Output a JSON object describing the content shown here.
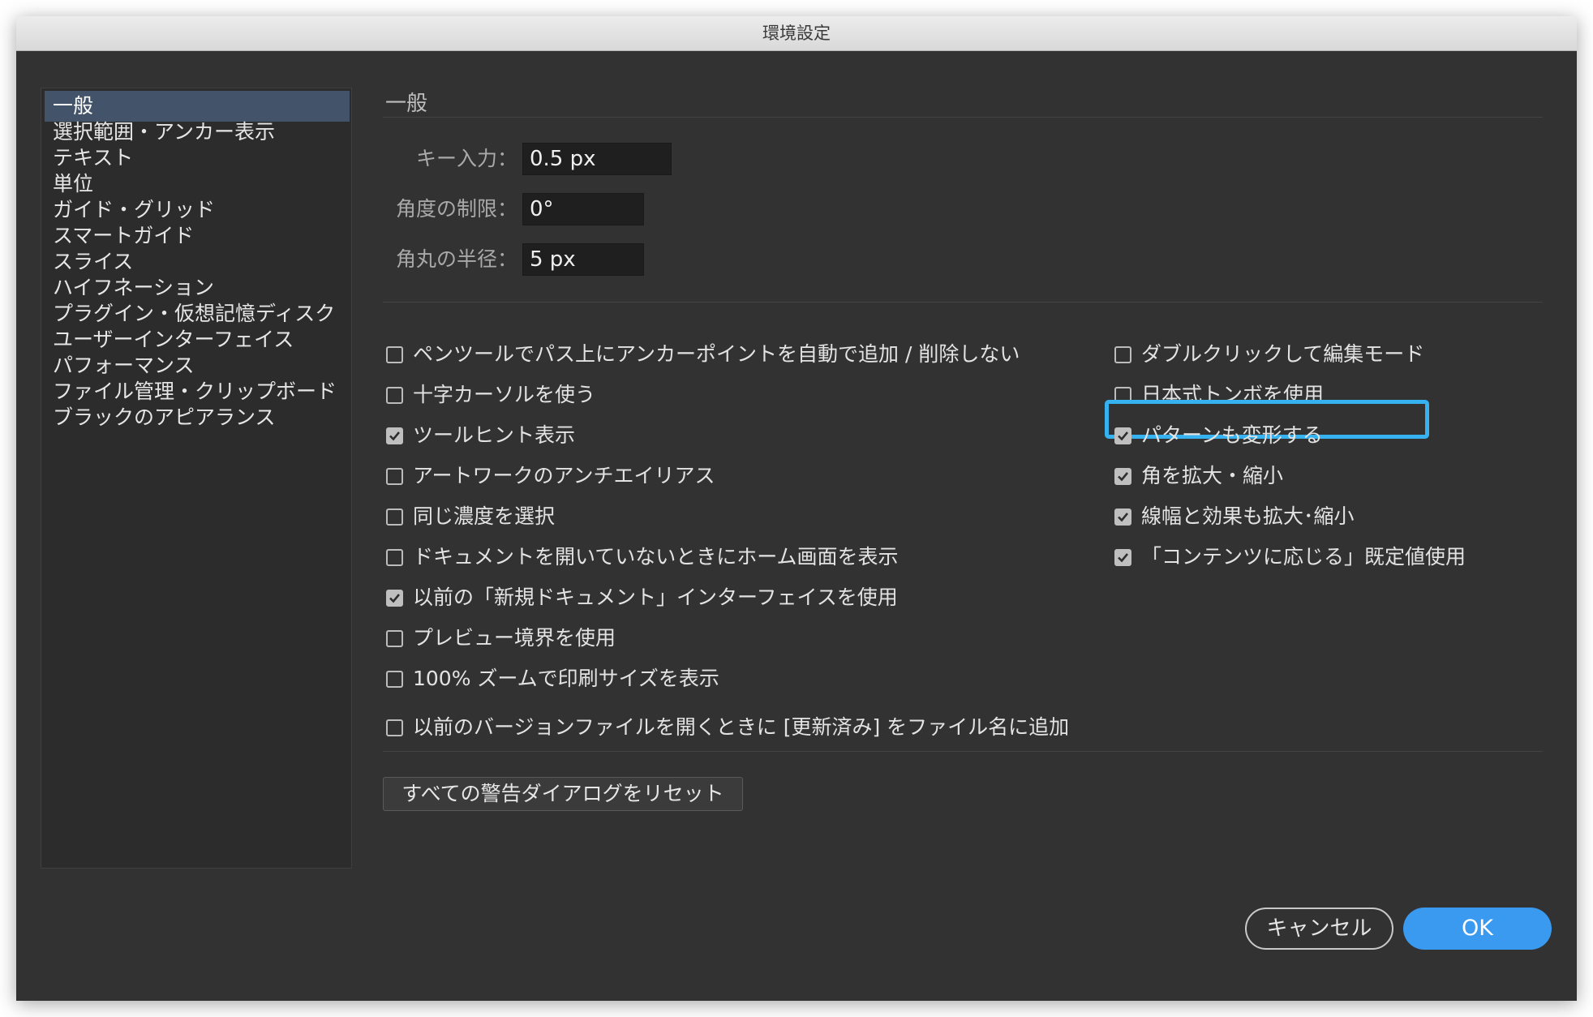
{
  "window": {
    "title": "環境設定"
  },
  "sidebar": {
    "items": [
      {
        "label": "一般",
        "selected": true
      },
      {
        "label": "選択範囲・アンカー表示",
        "selected": false
      },
      {
        "label": "テキスト",
        "selected": false
      },
      {
        "label": "単位",
        "selected": false
      },
      {
        "label": "ガイド・グリッド",
        "selected": false
      },
      {
        "label": "スマートガイド",
        "selected": false
      },
      {
        "label": "スライス",
        "selected": false
      },
      {
        "label": "ハイフネーション",
        "selected": false
      },
      {
        "label": "プラグイン・仮想記憶ディスク",
        "selected": false
      },
      {
        "label": "ユーザーインターフェイス",
        "selected": false
      },
      {
        "label": "パフォーマンス",
        "selected": false
      },
      {
        "label": "ファイル管理・クリップボード",
        "selected": false
      },
      {
        "label": "ブラックのアピアランス",
        "selected": false
      }
    ]
  },
  "main": {
    "section_title": "一般",
    "fields": {
      "key_input": {
        "label": "キー入力：",
        "value": "0.5 px"
      },
      "angle_limit": {
        "label": "角度の制限：",
        "value": "0°"
      },
      "corner_radius": {
        "label": "角丸の半径：",
        "value": "5 px"
      }
    },
    "left_checkboxes": [
      {
        "label": "ペンツールでパス上にアンカーポイントを自動で追加 / 削除しない",
        "checked": false
      },
      {
        "label": "十字カーソルを使う",
        "checked": false
      },
      {
        "label": "ツールヒント表示",
        "checked": true
      },
      {
        "label": "アートワークのアンチエイリアス",
        "checked": false
      },
      {
        "label": "同じ濃度を選択",
        "checked": false
      },
      {
        "label": "ドキュメントを開いていないときにホーム画面を表示",
        "checked": false
      },
      {
        "label": "以前の「新規ドキュメント」インターフェイスを使用",
        "checked": true
      },
      {
        "label": "プレビュー境界を使用",
        "checked": false
      },
      {
        "label": "100% ズームで印刷サイズを表示",
        "checked": false
      },
      {
        "label": "以前のバージョンファイルを開くときに [更新済み] をファイル名に追加",
        "checked": false
      }
    ],
    "right_checkboxes": [
      {
        "label": "ダブルクリックして編集モード",
        "checked": false
      },
      {
        "label": "日本式トンボを使用",
        "checked": false
      },
      {
        "label": "パターンも変形する",
        "checked": true,
        "highlighted": true
      },
      {
        "label": "角を拡大・縮小",
        "checked": true
      },
      {
        "label": "線幅と効果も拡大･縮小",
        "checked": true
      },
      {
        "label": "「コンテンツに応じる」既定値使用",
        "checked": true
      }
    ],
    "reset_button_label": "すべての警告ダイアログをリセット"
  },
  "footer": {
    "cancel_label": "キャンセル",
    "ok_label": "OK"
  },
  "colors": {
    "panel_bg": "#323232",
    "sidebar_selected": "#43546a",
    "highlight_border": "#36b2f0",
    "ok_button": "#3a9af0"
  }
}
